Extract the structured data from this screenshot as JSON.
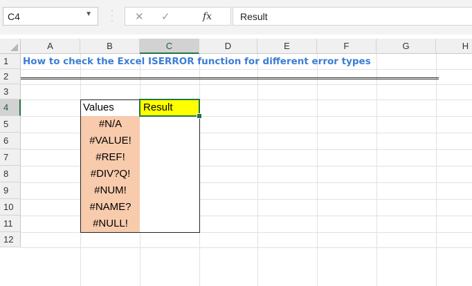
{
  "formula_bar": {
    "name_box": "C4",
    "formula": "Result"
  },
  "columns": [
    "A",
    "B",
    "C",
    "D",
    "E",
    "F",
    "G",
    "H"
  ],
  "rows": [
    "1",
    "2",
    "3",
    "4",
    "5",
    "6",
    "7",
    "8",
    "9",
    "10",
    "11",
    "12"
  ],
  "sheet": {
    "title": "How to check the Excel ISERROR function for different error types",
    "table": {
      "header_values": "Values",
      "header_result": "Result",
      "values": [
        "#N/A",
        "#VALUE!",
        "#REF!",
        "#DIV?Q!",
        "#NUM!",
        "#NAME?",
        "#NULL!"
      ]
    }
  },
  "colors": {
    "accent_green": "#217346",
    "title_blue": "#3a7dd6",
    "value_fill": "#f8cbad",
    "result_fill": "#ffff00"
  },
  "icons": [
    "dropdown-arrow-icon",
    "cancel-icon",
    "enter-icon",
    "insert-function-icon"
  ]
}
